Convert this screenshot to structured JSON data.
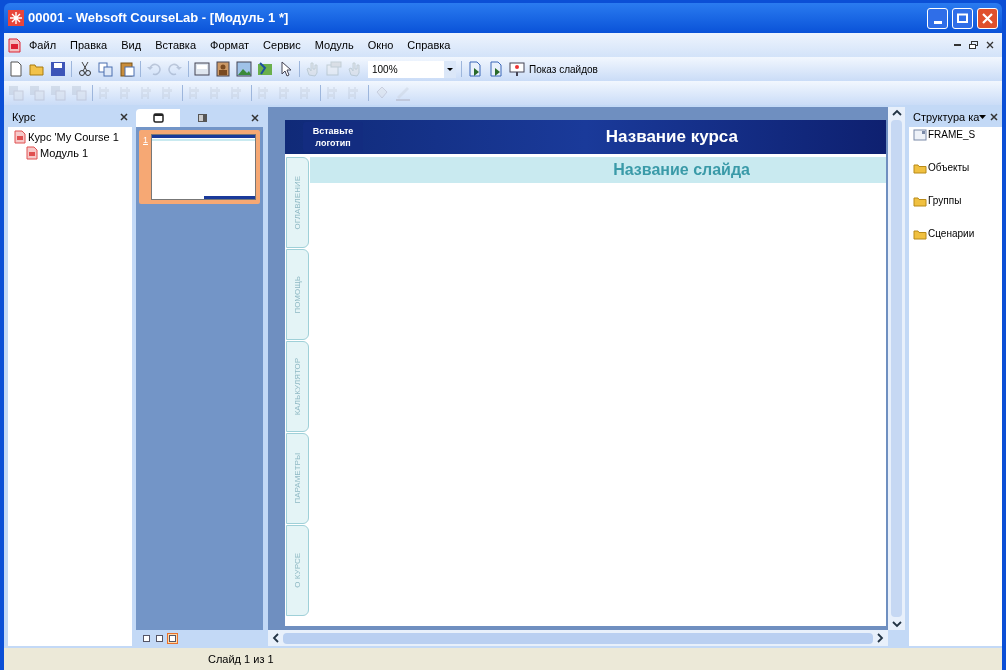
{
  "window": {
    "title": "00001 - Websoft CourseLab - [Модуль 1 *]"
  },
  "menu": [
    "Файл",
    "Правка",
    "Вид",
    "Вставка",
    "Формат",
    "Сервис",
    "Модуль",
    "Окно",
    "Справка"
  ],
  "toolbar": {
    "zoom": "100%",
    "slideshow": "Показ слайдов"
  },
  "format_toolbar": {
    "disabled": true
  },
  "course_panel": {
    "title": "Курс",
    "tree": [
      {
        "label": "Курс 'My Course 1",
        "children": [
          {
            "label": "Модуль 1"
          }
        ]
      }
    ]
  },
  "slides_panel": {
    "tabs": [
      {
        "selected": true
      },
      {
        "selected": false
      }
    ],
    "slides": [
      {
        "number": "1",
        "selected": true
      }
    ],
    "views": [
      {
        "selected": false
      },
      {
        "selected": false
      },
      {
        "selected": true
      }
    ]
  },
  "slide": {
    "logo": "Вставьте логотип",
    "course_title": "Название курса",
    "slide_title": "Название слайда",
    "side_tabs": [
      "ОГЛАВЛЕНИЕ",
      "ПОМОЩЬ",
      "КАЛЬКУЛЯТОР",
      "ПАРАМЕТРЫ",
      "О КУРСЕ"
    ]
  },
  "structure_panel": {
    "title": "Структура ка",
    "items": [
      {
        "kind": "frame",
        "label": "FRAME_S"
      },
      {
        "kind": "folder",
        "label": "Объекты"
      },
      {
        "kind": "folder",
        "label": "Группы"
      },
      {
        "kind": "folder",
        "label": "Сценарии"
      }
    ]
  },
  "status_bar": "Слайд 1 из 1"
}
